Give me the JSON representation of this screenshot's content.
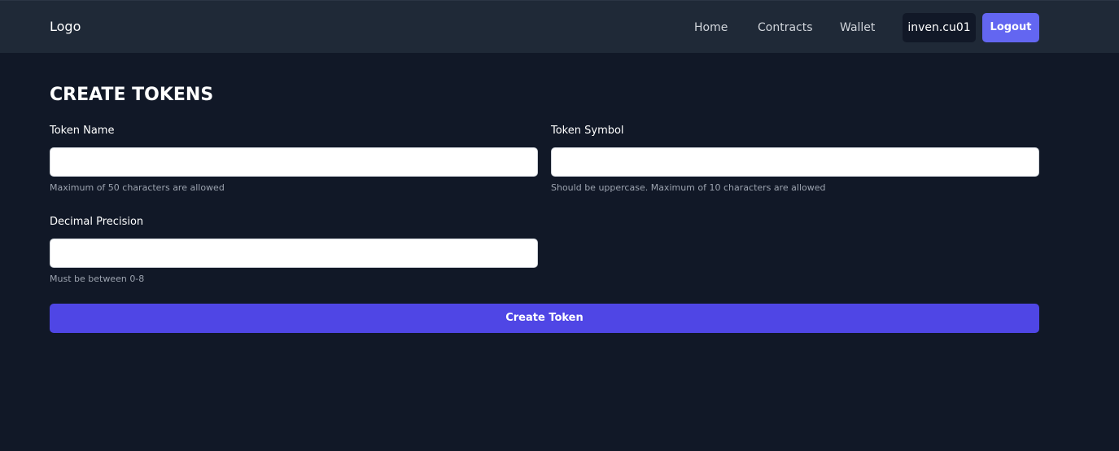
{
  "navbar": {
    "logo": "Logo",
    "links": [
      {
        "label": "Home"
      },
      {
        "label": "Contracts"
      },
      {
        "label": "Wallet"
      }
    ],
    "account": "inven.cu01",
    "logout_label": "Logout"
  },
  "form": {
    "title": "CREATE TOKENS",
    "token_name": {
      "label": "Token Name",
      "value": "",
      "help": "Maximum of 50 characters are allowed"
    },
    "token_symbol": {
      "label": "Token Symbol",
      "value": "",
      "help": "Should be uppercase. Maximum of 10 characters are allowed"
    },
    "decimal_precision": {
      "label": "Decimal Precision",
      "value": "",
      "help": "Must be between 0-8"
    },
    "submit_label": "Create Token"
  },
  "colors": {
    "background": "#111827",
    "navbar": "#1f2937",
    "primary": "#4f46e5",
    "logout": "#6366f1",
    "help_text": "#9ca3af"
  }
}
